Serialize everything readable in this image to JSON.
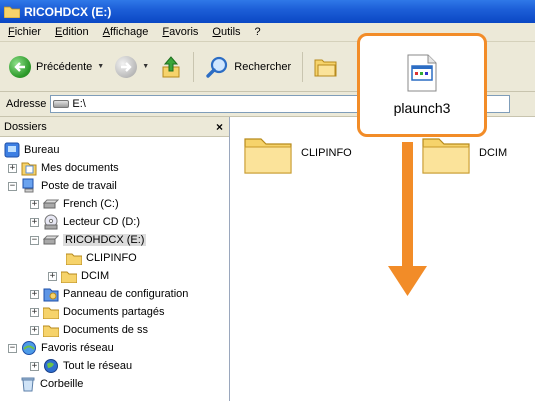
{
  "window": {
    "title": "RICOHDCX (E:)"
  },
  "menu": [
    "Fichier",
    "Edition",
    "Affichage",
    "Favoris",
    "Outils",
    "?"
  ],
  "toolbar": {
    "back_label": "Précédente",
    "search_label": "Rechercher"
  },
  "address": {
    "label": "Adresse",
    "value": "E:\\"
  },
  "folders_panel": {
    "title": "Dossiers",
    "close_glyph": "×",
    "items": [
      {
        "label": "Bureau",
        "icon": "desktop-icon"
      },
      {
        "label": "Mes documents",
        "icon": "my-documents-icon",
        "expander": "+"
      },
      {
        "label": "Poste de travail",
        "icon": "my-computer-icon",
        "expander": "−"
      },
      {
        "label": "French (C:)",
        "icon": "hard-drive-icon",
        "expander": "+"
      },
      {
        "label": "Lecteur CD (D:)",
        "icon": "cd-drive-icon",
        "expander": "+"
      },
      {
        "label": "RICOHDCX (E:)",
        "icon": "removable-drive-icon",
        "expander": "−",
        "selected": true
      },
      {
        "label": "CLIPINFO",
        "icon": "folder-icon"
      },
      {
        "label": "DCIM",
        "icon": "folder-icon",
        "expander": "+"
      },
      {
        "label": "Panneau de configuration",
        "icon": "control-panel-icon",
        "expander": "+"
      },
      {
        "label": "Documents partagés",
        "icon": "folder-icon",
        "expander": "+"
      },
      {
        "label": "Documents de ss",
        "icon": "folder-icon",
        "expander": "+"
      },
      {
        "label": "Favoris réseau",
        "icon": "network-icon",
        "expander": "−"
      },
      {
        "label": "Tout le réseau",
        "icon": "globe-icon",
        "expander": "+"
      },
      {
        "label": "Corbeille",
        "icon": "recycle-bin-icon"
      }
    ]
  },
  "content": {
    "items": [
      {
        "name": "CLIPINFO",
        "icon": "folder-icon"
      },
      {
        "name": "DCIM",
        "icon": "folder-icon"
      }
    ]
  },
  "callout": {
    "label": "plaunch3",
    "icon": "application-icon"
  },
  "colors": {
    "title_bar": "#0a47c4",
    "callout_border": "#f28c28",
    "arrow": "#f28c28"
  }
}
